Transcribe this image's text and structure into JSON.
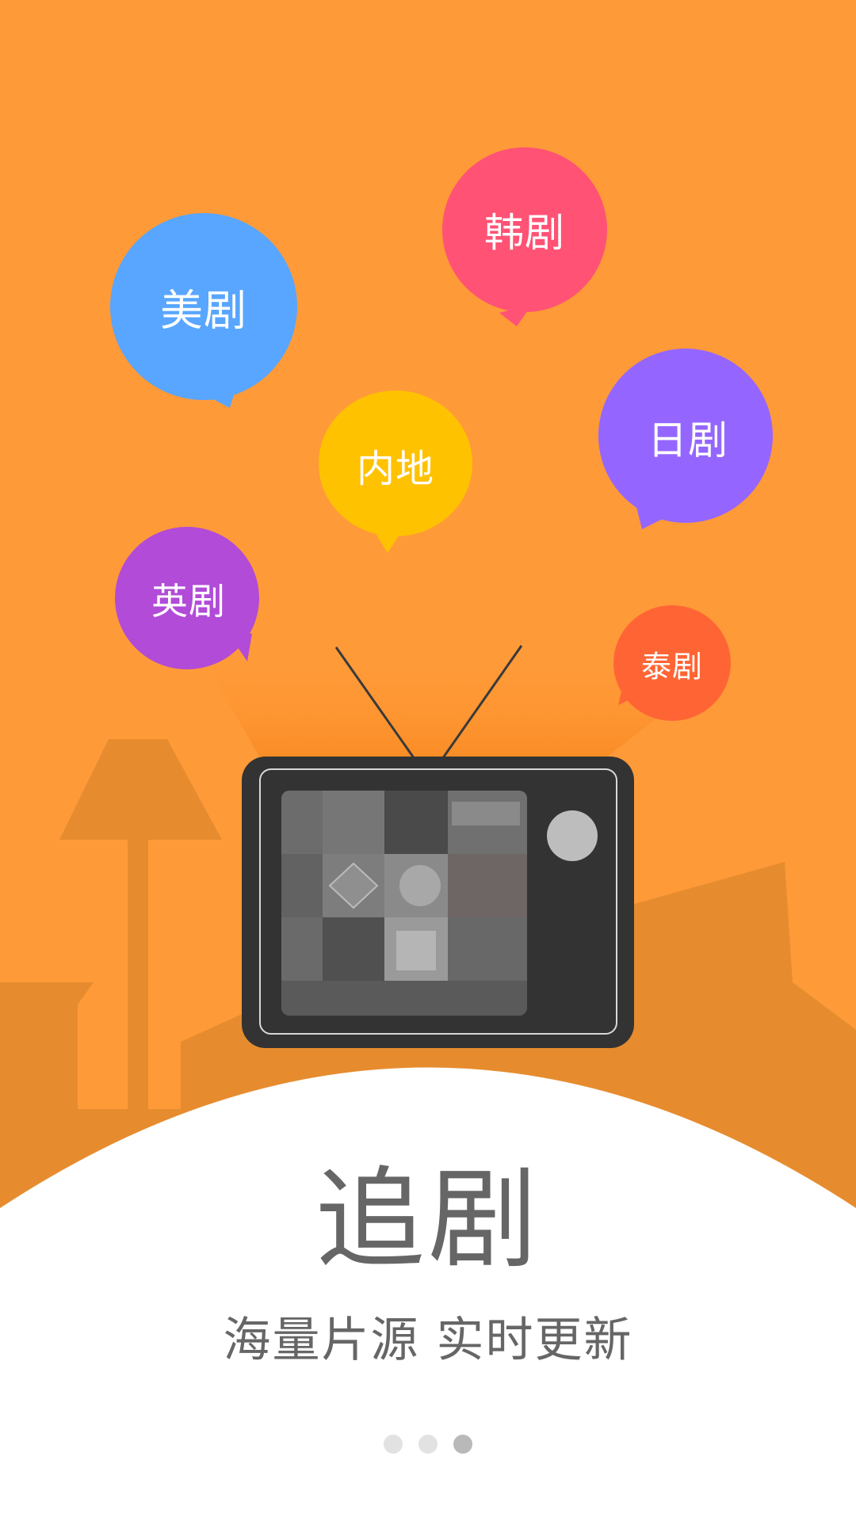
{
  "bubbles": {
    "us": {
      "label": "美剧",
      "color": "#58A6FF"
    },
    "korea": {
      "label": "韩剧",
      "color": "#FF5274"
    },
    "japan": {
      "label": "日剧",
      "color": "#9566FF"
    },
    "mainland": {
      "label": "内地",
      "color": "#FFC200"
    },
    "uk": {
      "label": "英剧",
      "color": "#B14BD8"
    },
    "thailand": {
      "label": "泰剧",
      "color": "#FF6534"
    }
  },
  "title": "追剧",
  "subtitle": "海量片源 实时更新",
  "pager": {
    "total": 3,
    "active": 3
  },
  "colors": {
    "background": "#FF9A38",
    "silhouette": "#E68C2F",
    "tv_body": "#333333",
    "text": "#666666"
  },
  "icons": {
    "tv": "retro-tv-icon",
    "lamp": "floor-lamp-icon"
  }
}
